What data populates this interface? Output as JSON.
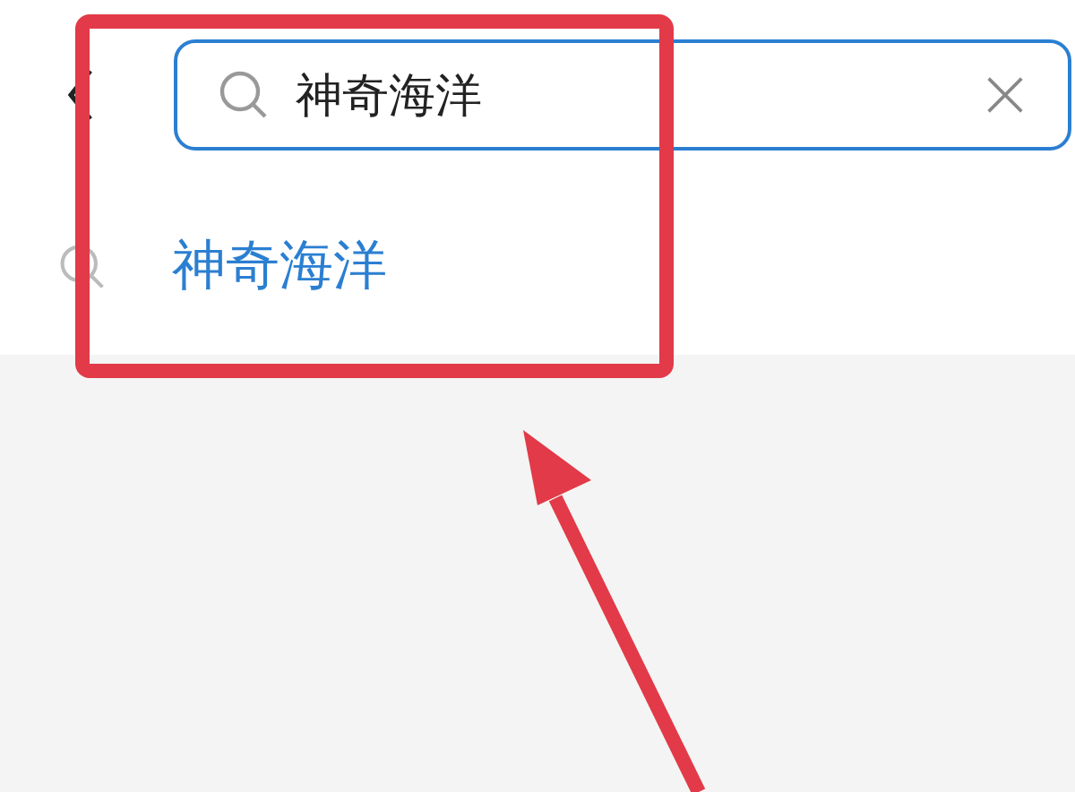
{
  "search": {
    "value": "神奇海洋"
  },
  "suggestions": [
    {
      "text": "神奇海洋"
    }
  ],
  "annotations": {
    "highlight_box": true,
    "arrow": true
  }
}
